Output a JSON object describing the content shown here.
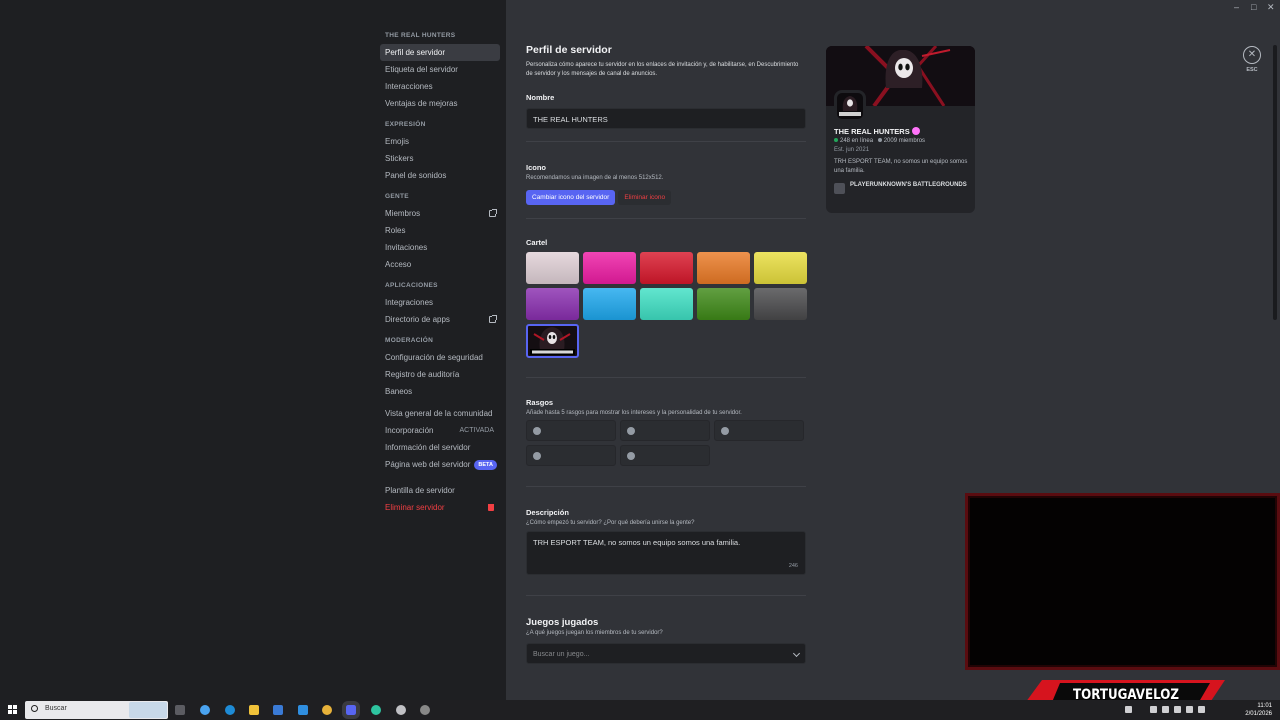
{
  "sidebar": {
    "server_title": "THE REAL HUNTERS",
    "items_main": [
      {
        "label": "Perfil de servidor"
      },
      {
        "label": "Etiqueta del servidor"
      },
      {
        "label": "Interacciones"
      },
      {
        "label": "Ventajas de mejoras"
      }
    ],
    "expresion_title": "EXPRESIÓN",
    "items_expresion": [
      {
        "label": "Emojis"
      },
      {
        "label": "Stickers"
      },
      {
        "label": "Panel de sonidos"
      }
    ],
    "gente_title": "GENTE",
    "items_gente": [
      {
        "label": "Miembros"
      },
      {
        "label": "Roles"
      },
      {
        "label": "Invitaciones"
      },
      {
        "label": "Acceso"
      }
    ],
    "aplicaciones_title": "APLICACIONES",
    "items_aplicaciones": [
      {
        "label": "Integraciones"
      },
      {
        "label": "Directorio de apps"
      }
    ],
    "moderacion_title": "MODERACIÓN",
    "items_moderacion": [
      {
        "label": "Configuración de seguridad"
      },
      {
        "label": "Registro de auditoría"
      },
      {
        "label": "Baneos"
      }
    ],
    "items_comunidad": [
      {
        "label": "Vista general de la comunidad"
      },
      {
        "label": "Incorporación",
        "trail": "ACTIVADA"
      },
      {
        "label": "Información del servidor"
      },
      {
        "label": "Página web del servidor",
        "badge": "BETA"
      }
    ],
    "items_final": [
      {
        "label": "Plantilla de servidor"
      },
      {
        "label": "Eliminar servidor"
      }
    ]
  },
  "main": {
    "title": "Perfil de servidor",
    "description": "Personaliza cómo aparece tu servidor en los enlaces de invitación y, de habilitarse, en Descubrimiento de servidor y los mensajes de canal de anuncios.",
    "name_label": "Nombre",
    "name_value": "THE REAL HUNTERS",
    "icon_label": "Icono",
    "icon_sub": "Recomendamos una imagen de al menos 512x512.",
    "change_icon_button": "Cambiar icono del servidor",
    "remove_icon_button": "Eliminar icono",
    "banner_label": "Cartel",
    "banner_colors": [
      "#e0d0d6",
      "#ee1ca4",
      "#d8182c",
      "#ea7a26",
      "#e8dd3e",
      "#8a2fb0",
      "#1ea8ee",
      "#3fe0c4",
      "#3f8a18",
      "#4a4a4c"
    ],
    "traits_label": "Rasgos",
    "traits_sub": "Añade hasta 5 rasgos para mostrar los intereses y la personalidad de tu servidor.",
    "description_label": "Descripción",
    "description_sub": "¿Cómo empezó tu servidor? ¿Por qué debería unirse la gente?",
    "description_value": "TRH ESPORT TEAM, no somos un equipo somos una familia.",
    "description_count": "246",
    "games_label": "Juegos jugados",
    "games_sub": "¿A qué juegos juegan los miembros de tu servidor?",
    "games_placeholder": "Buscar un juego..."
  },
  "preview": {
    "name": "THE REAL HUNTERS",
    "online": "248 en línea",
    "members": "2009 miembros",
    "established": "Est. jun 2021",
    "description": "TRH ESPORT TEAM, no somos un equipo somos una familia.",
    "game": "PLAYERUNKNOWN'S BATTLEGROUNDS"
  },
  "esc_label": "ESC",
  "overlay": {
    "brand_text": "TORTUGAVELOZ"
  },
  "taskbar": {
    "search_label": "Buscar",
    "time": "11:01",
    "date": "2/01/2026"
  },
  "colors": {
    "accent": "#5865f2",
    "danger": "#f23f43",
    "online": "#23a55a"
  }
}
